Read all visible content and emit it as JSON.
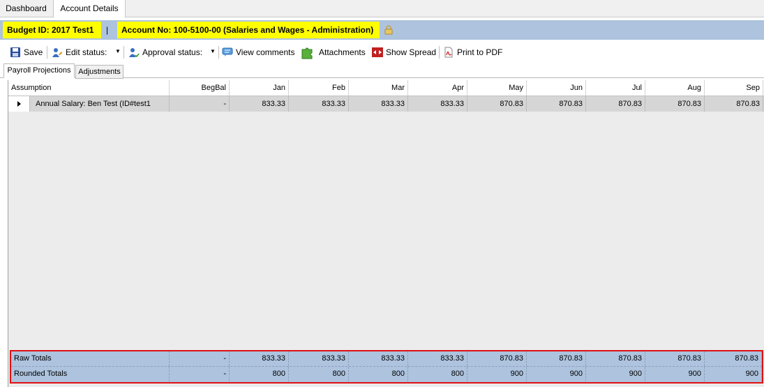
{
  "top_tabs": [
    "Dashboard",
    "Account Details"
  ],
  "info_bar": {
    "budget_id": "Budget ID: 2017 Test1",
    "separator": "|",
    "account_no": "Account No: 100-5100-00 (Salaries and Wages - Administration)"
  },
  "toolbar": {
    "save": "Save",
    "edit_status": "Edit status:",
    "approval_status": "Approval status:",
    "view_comments": "View comments",
    "attachments": "Attachments",
    "show_spread": "Show Spread",
    "print_pdf": "Print to PDF"
  },
  "inner_tabs": [
    "Payroll Projections",
    "Adjustments"
  ],
  "grid": {
    "columns": [
      "Assumption",
      "BegBal",
      "Jan",
      "Feb",
      "Mar",
      "Apr",
      "May",
      "Jun",
      "Jul",
      "Aug",
      "Sep"
    ],
    "row": {
      "assumption": "Annual Salary: Ben  Test (ID#test1",
      "begbal": "-",
      "values": [
        "833.33",
        "833.33",
        "833.33",
        "833.33",
        "870.83",
        "870.83",
        "870.83",
        "870.83",
        "870.83"
      ]
    },
    "raw_totals": {
      "label": "Raw Totals",
      "begbal": "-",
      "values": [
        "833.33",
        "833.33",
        "833.33",
        "833.33",
        "870.83",
        "870.83",
        "870.83",
        "870.83",
        "870.83"
      ]
    },
    "rounded_totals": {
      "label": "Rounded Totals",
      "begbal": "-",
      "values": [
        "800",
        "800",
        "800",
        "800",
        "900",
        "900",
        "900",
        "900",
        "900"
      ]
    }
  },
  "colors": {
    "info_bar": "#adc3de",
    "badge": "#ffff00",
    "highlight_border": "#e01010",
    "row_bg": "#d6d6d6"
  }
}
